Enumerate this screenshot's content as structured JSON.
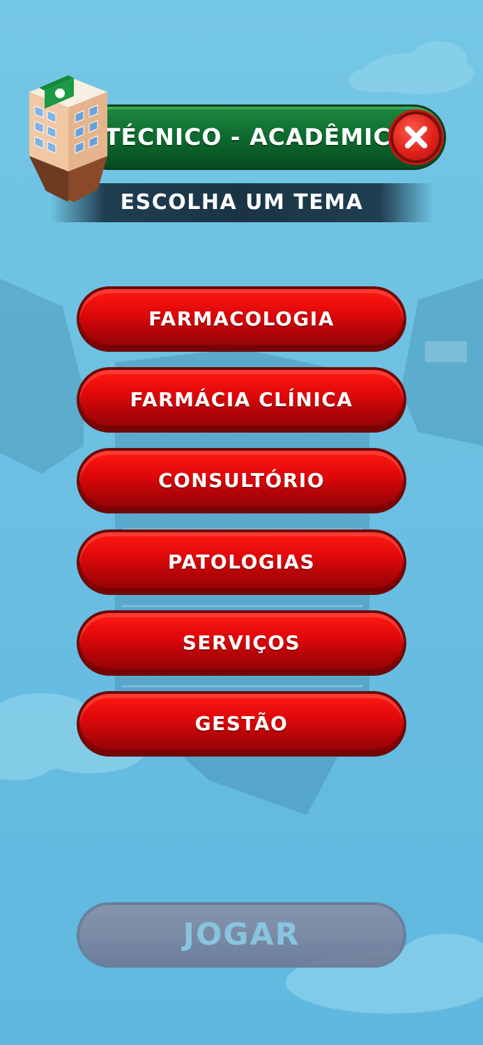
{
  "header": {
    "title": "TÉCNICO - ACADÊMICO",
    "subtitle": "ESCOLHA UM TEMA",
    "close_icon": "close-icon"
  },
  "topics": [
    {
      "label": "FARMACOLOGIA"
    },
    {
      "label": "FARMÁCIA CLÍNICA"
    },
    {
      "label": "CONSULTÓRIO"
    },
    {
      "label": "PATOLOGIAS"
    },
    {
      "label": "SERVIÇOS"
    },
    {
      "label": "GESTÃO"
    }
  ],
  "play": {
    "label": "JOGAR",
    "state": "disabled"
  },
  "colors": {
    "background": "#6cc0e2",
    "title_bar": "#0f6d30",
    "topic_button": "#d0070a",
    "close_button": "#e0231b",
    "play_disabled": "#7f839c"
  }
}
